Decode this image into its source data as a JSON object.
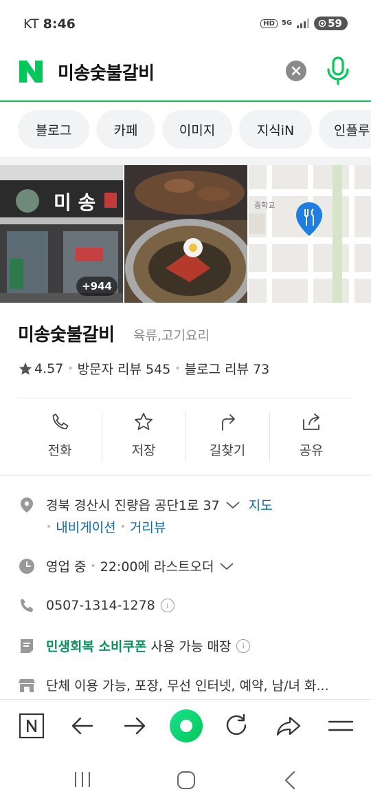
{
  "status_bar": {
    "carrier": "KT",
    "time": "8:46",
    "hd": "HD",
    "network": "5G",
    "battery": "59"
  },
  "search": {
    "query": "미송숯불갈비",
    "logo": "N"
  },
  "tabs": [
    {
      "label": "블로그"
    },
    {
      "label": "카페"
    },
    {
      "label": "이미지"
    },
    {
      "label": "지식iN"
    },
    {
      "label": "인플루"
    }
  ],
  "photos": {
    "count_badge": "+944",
    "map_label": "중학교"
  },
  "place": {
    "name": "미송숯불갈비",
    "category": "육류,고기요리",
    "rating": "4.57",
    "visitor_reviews": "방문자 리뷰 545",
    "blog_reviews": "블로그 리뷰 73"
  },
  "actions": [
    {
      "label": "전화",
      "icon": "phone-icon"
    },
    {
      "label": "저장",
      "icon": "star-icon"
    },
    {
      "label": "길찾기",
      "icon": "directions-icon"
    },
    {
      "label": "공유",
      "icon": "share-icon"
    }
  ],
  "details": {
    "address": "경북 경산시 진량읍 공단1로 37",
    "map_link": "지도",
    "navigation_link": "내비게이션",
    "street_view_link": "거리뷰",
    "status": "영업 중",
    "last_order": "22:00에 라스트오더",
    "phone": "0507-1314-1278",
    "coupon_highlight": "민생회복 소비쿠폰",
    "coupon_text": "사용 가능 매장",
    "amenities": "단체 이용 가능, 포장, 무선 인터넷, 예약, 남/녀 화..."
  },
  "colors": {
    "naver_green": "#03c75a",
    "link_blue": "#0c6ab5",
    "coupon_green": "#0c8f5f"
  }
}
